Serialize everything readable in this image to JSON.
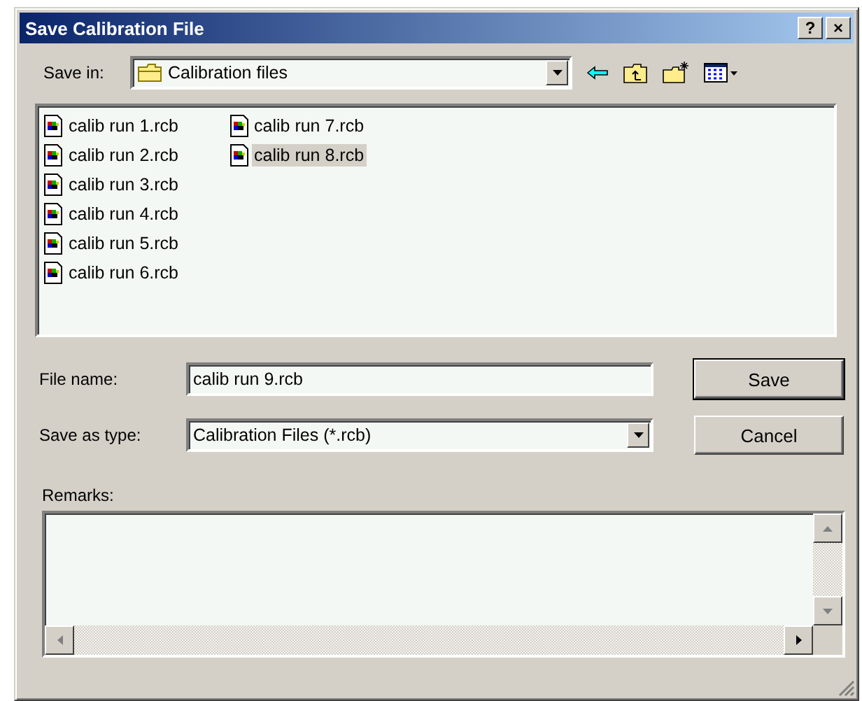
{
  "window": {
    "title": "Save Calibration File",
    "title_buttons": [
      "?",
      "×"
    ]
  },
  "save_in": {
    "label": "Save in:",
    "value": "Calibration files"
  },
  "files": [
    {
      "name": "calib run 1.rcb",
      "selected": false
    },
    {
      "name": "calib run 2.rcb",
      "selected": false
    },
    {
      "name": "calib run 3.rcb",
      "selected": false
    },
    {
      "name": "calib run 4.rcb",
      "selected": false
    },
    {
      "name": "calib run 5.rcb",
      "selected": false
    },
    {
      "name": "calib run 6.rcb",
      "selected": false
    },
    {
      "name": "calib run 7.rcb",
      "selected": false
    },
    {
      "name": "calib run 8.rcb",
      "selected": true
    }
  ],
  "file_name": {
    "label": "File name:",
    "value": "calib run 9.rcb"
  },
  "save_as_type": {
    "label": "Save as type:",
    "value": "Calibration Files (*.rcb)"
  },
  "buttons": [
    {
      "label": "Save",
      "default": true
    },
    {
      "label": "Cancel",
      "default": false
    }
  ],
  "remarks": {
    "label": "Remarks:"
  }
}
